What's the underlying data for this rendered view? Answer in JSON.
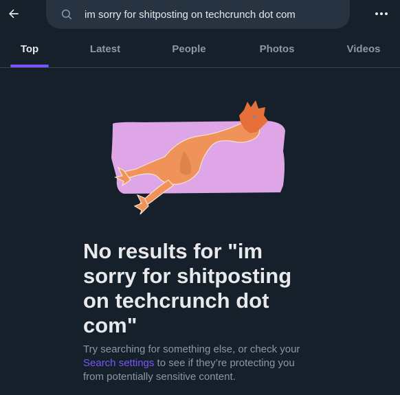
{
  "header": {
    "back_icon": "arrow-left-icon",
    "search": {
      "icon": "search-icon",
      "value": "im sorry for shitposting on techcrunch dot com"
    },
    "more_icon": "more-horizontal-icon"
  },
  "tabs": [
    {
      "label": "Top",
      "active": true
    },
    {
      "label": "Latest",
      "active": false
    },
    {
      "label": "People",
      "active": false
    },
    {
      "label": "Photos",
      "active": false
    },
    {
      "label": "Videos",
      "active": false
    }
  ],
  "colors": {
    "background": "#15202b",
    "accent": "#7856ff",
    "search_bg": "#273340",
    "illustration_bg": "#dea6e6",
    "chicken": "#f0935a"
  },
  "empty_state": {
    "illustration": "rubber-chicken-illustration",
    "title": "No results for \"im sorry for shitposting on techcrunch dot com\"",
    "body_before_link": "Try searching for something else, or check your ",
    "link": "Search settings",
    "body_after_link": " to see if they’re protecting you from potentially sensitive content."
  }
}
